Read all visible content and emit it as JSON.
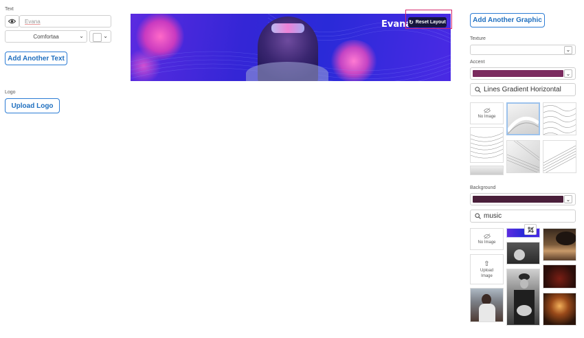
{
  "text_section": {
    "label": "Text",
    "text_value": "Evana",
    "font_value": "Comfortaa",
    "add_text_label": "Add Another Text"
  },
  "logo_section": {
    "label": "Logo",
    "upload_label": "Upload Logo"
  },
  "preview": {
    "overlay_text": "Evana",
    "reset_label": "Reset Layout"
  },
  "graphics": {
    "add_graphic_label": "Add Another Graphic",
    "texture_label": "Texture",
    "accent_label": "Accent",
    "accent_color": "#7a2a5e",
    "texture_search": "Lines Gradient Horizontal",
    "no_image_label": "No Image",
    "background_label": "Background",
    "background_color": "#4a1f3a",
    "background_search": "music",
    "upload_image_label": "Upload Image"
  },
  "colors": {
    "accent_blue": "#2a7bd4",
    "highlight_red": "#d4266b",
    "banner_base": "#3a2cd8"
  }
}
